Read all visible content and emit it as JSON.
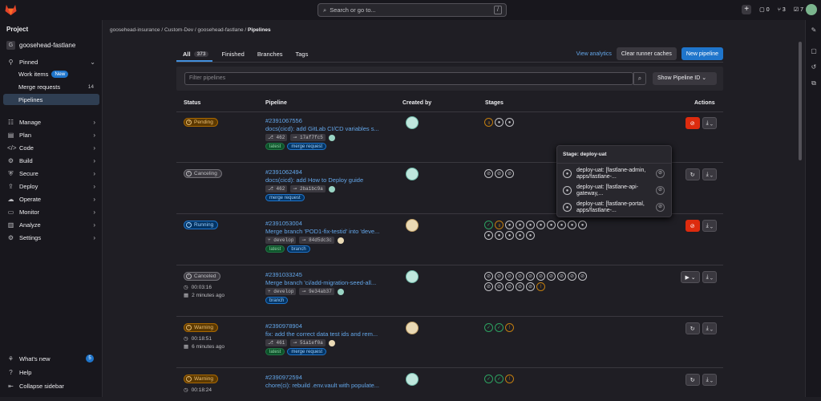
{
  "topbar": {
    "search_placeholder": "Search or go to...",
    "search_kbd": "/",
    "issues_count": "0",
    "mr_count": "3",
    "todo_count": "7"
  },
  "sidebar": {
    "header": "Project",
    "project_initial": "G",
    "project_name": "goosehead-fastlane",
    "pinned": "Pinned",
    "pinned_items": [
      {
        "label": "Work items",
        "badge": "New"
      },
      {
        "label": "Merge requests",
        "count": "14"
      },
      {
        "label": "Pipelines"
      }
    ],
    "nav": [
      "Manage",
      "Plan",
      "Code",
      "Build",
      "Secure",
      "Deploy",
      "Operate",
      "Monitor",
      "Analyze",
      "Settings"
    ],
    "whats_new": "What's new",
    "whats_new_count": "5",
    "help": "Help",
    "collapse": "Collapse sidebar"
  },
  "breadcrumb": [
    "goosehead-insurance",
    "Custom-Dev",
    "goosehead-fastlane",
    "Pipelines"
  ],
  "tabs": [
    {
      "label": "All",
      "count": "373"
    },
    {
      "label": "Finished"
    },
    {
      "label": "Branches"
    },
    {
      "label": "Tags"
    }
  ],
  "actions": {
    "analytics": "View analytics",
    "clear_cache": "Clear runner caches",
    "new_pipeline": "New pipeline"
  },
  "filter": {
    "placeholder": "Filter pipelines",
    "show": "Show Pipeline ID"
  },
  "columns": {
    "status": "Status",
    "pipeline": "Pipeline",
    "created_by": "Created by",
    "stages": "Stages",
    "actions": "Actions"
  },
  "rows": [
    {
      "status": "Pending",
      "id": "#2391067556",
      "title": "docs(cicd): add GitLab CI/CD variables s...",
      "ref_icon": "⎇",
      "ref": "462",
      "sha": "17af7fc5",
      "tags": [
        "latest",
        "merge request"
      ]
    },
    {
      "status": "Canceling",
      "id": "#2391062494",
      "title": "docs(cicd): add How to Deploy guide",
      "ref_icon": "⎇",
      "ref": "462",
      "sha": "2ba1bc9a",
      "tags": [
        "merge request"
      ]
    },
    {
      "status": "Running",
      "id": "#2391053004",
      "title": "Merge branch 'POD1-fix-testid' into 'deve...",
      "ref_icon": "⑂",
      "ref": "develop",
      "sha": "84d5dc3c",
      "tags": [
        "latest",
        "branch"
      ]
    },
    {
      "status": "Canceled",
      "duration": "00:03:16",
      "ago": "2 minutes ago",
      "id": "#2391033245",
      "title": "Merge branch 'ci/add-migration-seed-all...",
      "ref_icon": "⑂",
      "ref": "develop",
      "sha": "9e34ab37",
      "tags": [
        "branch"
      ]
    },
    {
      "status": "Warning",
      "duration": "00:18:51",
      "ago": "6 minutes ago",
      "id": "#2390978904",
      "title": "fix: add the correct data test ids and rem...",
      "ref_icon": "⎇",
      "ref": "461",
      "sha": "51a1ef0a",
      "tags": [
        "latest",
        "merge request"
      ]
    },
    {
      "status": "Warning",
      "duration": "00:18:24",
      "id": "#2390972594",
      "title": "chore(ci): rebuild .env.vault with populate...",
      "tags": []
    }
  ],
  "popover": {
    "title": "Stage: deploy-uat",
    "items": [
      "deploy-uat: [fastlane-admin, apps/fastlane-...",
      "deploy-uat: [fastlane-api-gateway,...",
      "deploy-uat: [fastlane-portal, apps/fastlane-..."
    ]
  }
}
